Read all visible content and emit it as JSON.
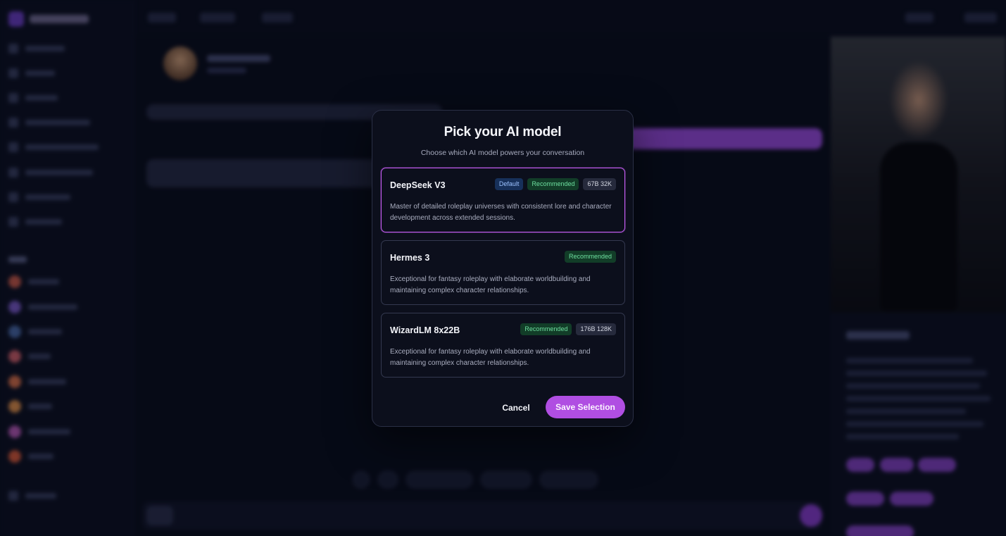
{
  "modal": {
    "title": "Pick your AI model",
    "subtitle": "Choose which AI model powers your conversation",
    "models": [
      {
        "name": "DeepSeek V3",
        "badges": {
          "default": "Default",
          "recommended": "Recommended",
          "spec": "67B 32K"
        },
        "description": "Master of detailed roleplay universes with consistent lore and character development across extended sessions.",
        "selected": true
      },
      {
        "name": "Hermes 3",
        "badges": {
          "recommended": "Recommended"
        },
        "description": "Exceptional for fantasy roleplay with elaborate worldbuilding and maintaining complex character relationships.",
        "selected": false
      },
      {
        "name": "WizardLM 8x22B",
        "badges": {
          "recommended": "Recommended",
          "spec": "176B 128K"
        },
        "description": "Exceptional for fantasy roleplay with elaborate worldbuilding and maintaining complex character relationships.",
        "selected": false
      }
    ],
    "cancel_label": "Cancel",
    "save_label": "Save Selection"
  },
  "colors": {
    "accent": "#b04ee2",
    "selected_border": "#c35cf0",
    "recommended_text": "#6ee0a0",
    "default_text": "#9cc2ff"
  }
}
